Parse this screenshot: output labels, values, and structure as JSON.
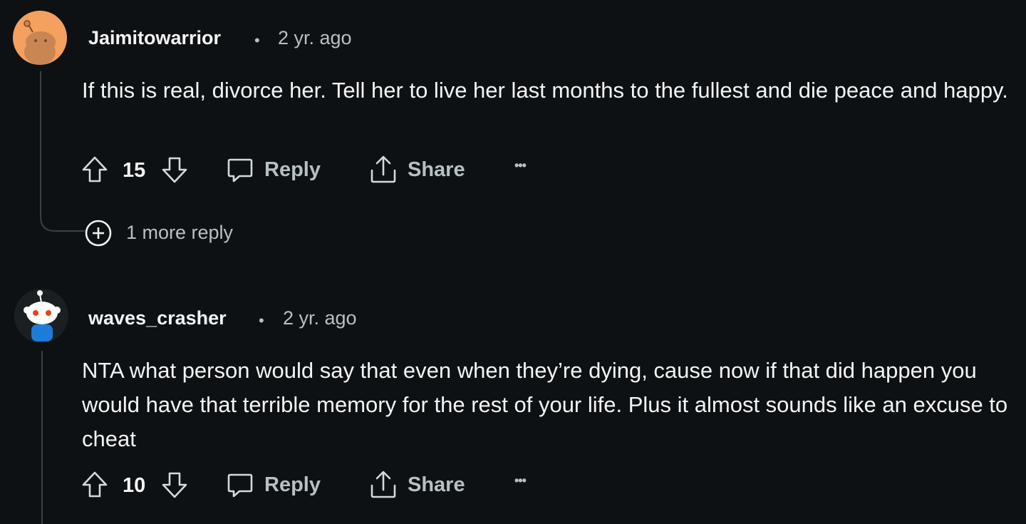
{
  "comments": [
    {
      "username": "Jaimitowarrior",
      "separator": "•",
      "time": "2 yr. ago",
      "text": "If this is real, divorce her. Tell her to live her last months to the fullest and die peace and happy.",
      "score": "15",
      "reply_label": "Reply",
      "share_label": "Share",
      "more_label": "•••",
      "avatar_color": "#f5a05f",
      "more_replies": "1 more reply"
    },
    {
      "username": "waves_crasher",
      "separator": "•",
      "time": "2 yr. ago",
      "text": "NTA what person would say that even when they’re dying, cause now if that did happen you would have that terrible memory for the rest of your life. Plus it almost sounds like an excuse to cheat",
      "score": "10",
      "reply_label": "Reply",
      "share_label": "Share",
      "more_label": "•••",
      "avatar_color": "#1a1f22"
    }
  ],
  "icons": {
    "upvote": "upvote-icon",
    "downvote": "downvote-icon",
    "reply": "reply-icon",
    "share": "share-icon",
    "more": "more-options-icon",
    "expand": "plus-circle-icon"
  }
}
